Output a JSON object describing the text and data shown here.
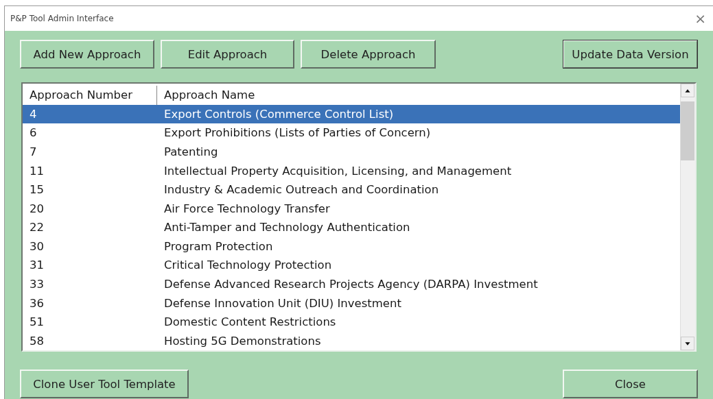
{
  "window": {
    "title": "P&P Tool Admin Interface",
    "close": "×"
  },
  "toolbar": [
    {
      "label": "Add New Approach",
      "default": false
    },
    {
      "label": "Edit Approach",
      "default": false
    },
    {
      "label": "Delete Approach",
      "default": false
    },
    {
      "label": "Update Data Version",
      "default": true
    }
  ],
  "table": {
    "columns": [
      "Approach Number",
      "Approach Name"
    ],
    "rows": [
      {
        "number": "4",
        "name": "Export Controls (Commerce Control List)",
        "selected": true
      },
      {
        "number": "6",
        "name": "Export Prohibitions (Lists of Parties of Concern)",
        "selected": false
      },
      {
        "number": "7",
        "name": "Patenting",
        "selected": false
      },
      {
        "number": "11",
        "name": "Intellectual Property Acquisition, Licensing, and Management",
        "selected": false
      },
      {
        "number": "15",
        "name": "Industry & Academic Outreach and Coordination",
        "selected": false
      },
      {
        "number": "20",
        "name": "Air Force Technology Transfer",
        "selected": false
      },
      {
        "number": "22",
        "name": "Anti-Tamper and Technology Authentication",
        "selected": false
      },
      {
        "number": "30",
        "name": "Program Protection",
        "selected": false
      },
      {
        "number": "31",
        "name": "Critical Technology Protection",
        "selected": false
      },
      {
        "number": "33",
        "name": "Defense Advanced Research Projects Agency (DARPA) Investment",
        "selected": false
      },
      {
        "number": "36",
        "name": "Defense Innovation Unit (DIU) Investment",
        "selected": false
      },
      {
        "number": "51",
        "name": "Domestic Content Restrictions",
        "selected": false
      },
      {
        "number": "58",
        "name": "Hosting 5G Demonstrations",
        "selected": false
      }
    ]
  },
  "footer": [
    {
      "label": "Clone User Tool Template",
      "default": false
    },
    {
      "label": "Close",
      "default": false
    }
  ]
}
